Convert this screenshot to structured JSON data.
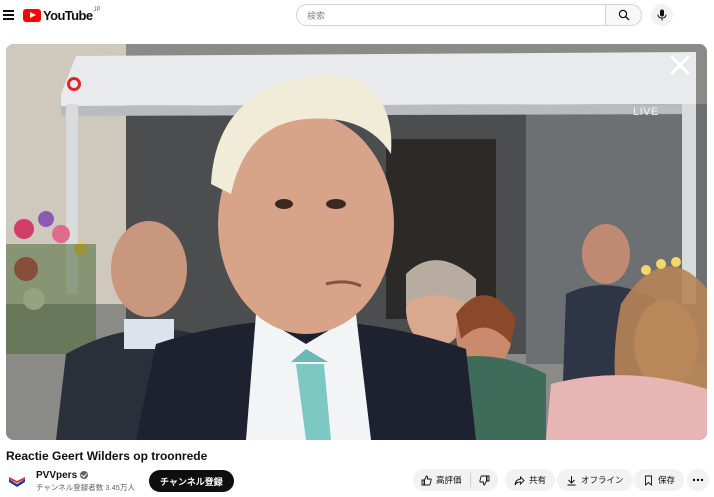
{
  "masthead": {
    "logo_text": "YouTube",
    "logo_region": "JP",
    "search_placeholder": "検索"
  },
  "player": {
    "live_label": "LIVE",
    "accent_color": "#e5242a"
  },
  "video": {
    "title": "Reactie Geert Wilders op troonrede"
  },
  "channel": {
    "name": "PVVpers",
    "subscribers": "チャンネル登録者数 3.45万人",
    "subscribe_label": "チャンネル登録"
  },
  "actions": {
    "like_label": "高評価",
    "share_label": "共有",
    "offline_label": "オフライン",
    "save_label": "保存"
  },
  "icons": [
    "menu-icon",
    "youtube-logo-icon",
    "search-icon",
    "mic-icon",
    "close-icon",
    "thumbs-up-icon",
    "thumbs-down-icon",
    "share-icon",
    "download-icon",
    "bookmark-icon",
    "more-icon",
    "verified-icon"
  ]
}
